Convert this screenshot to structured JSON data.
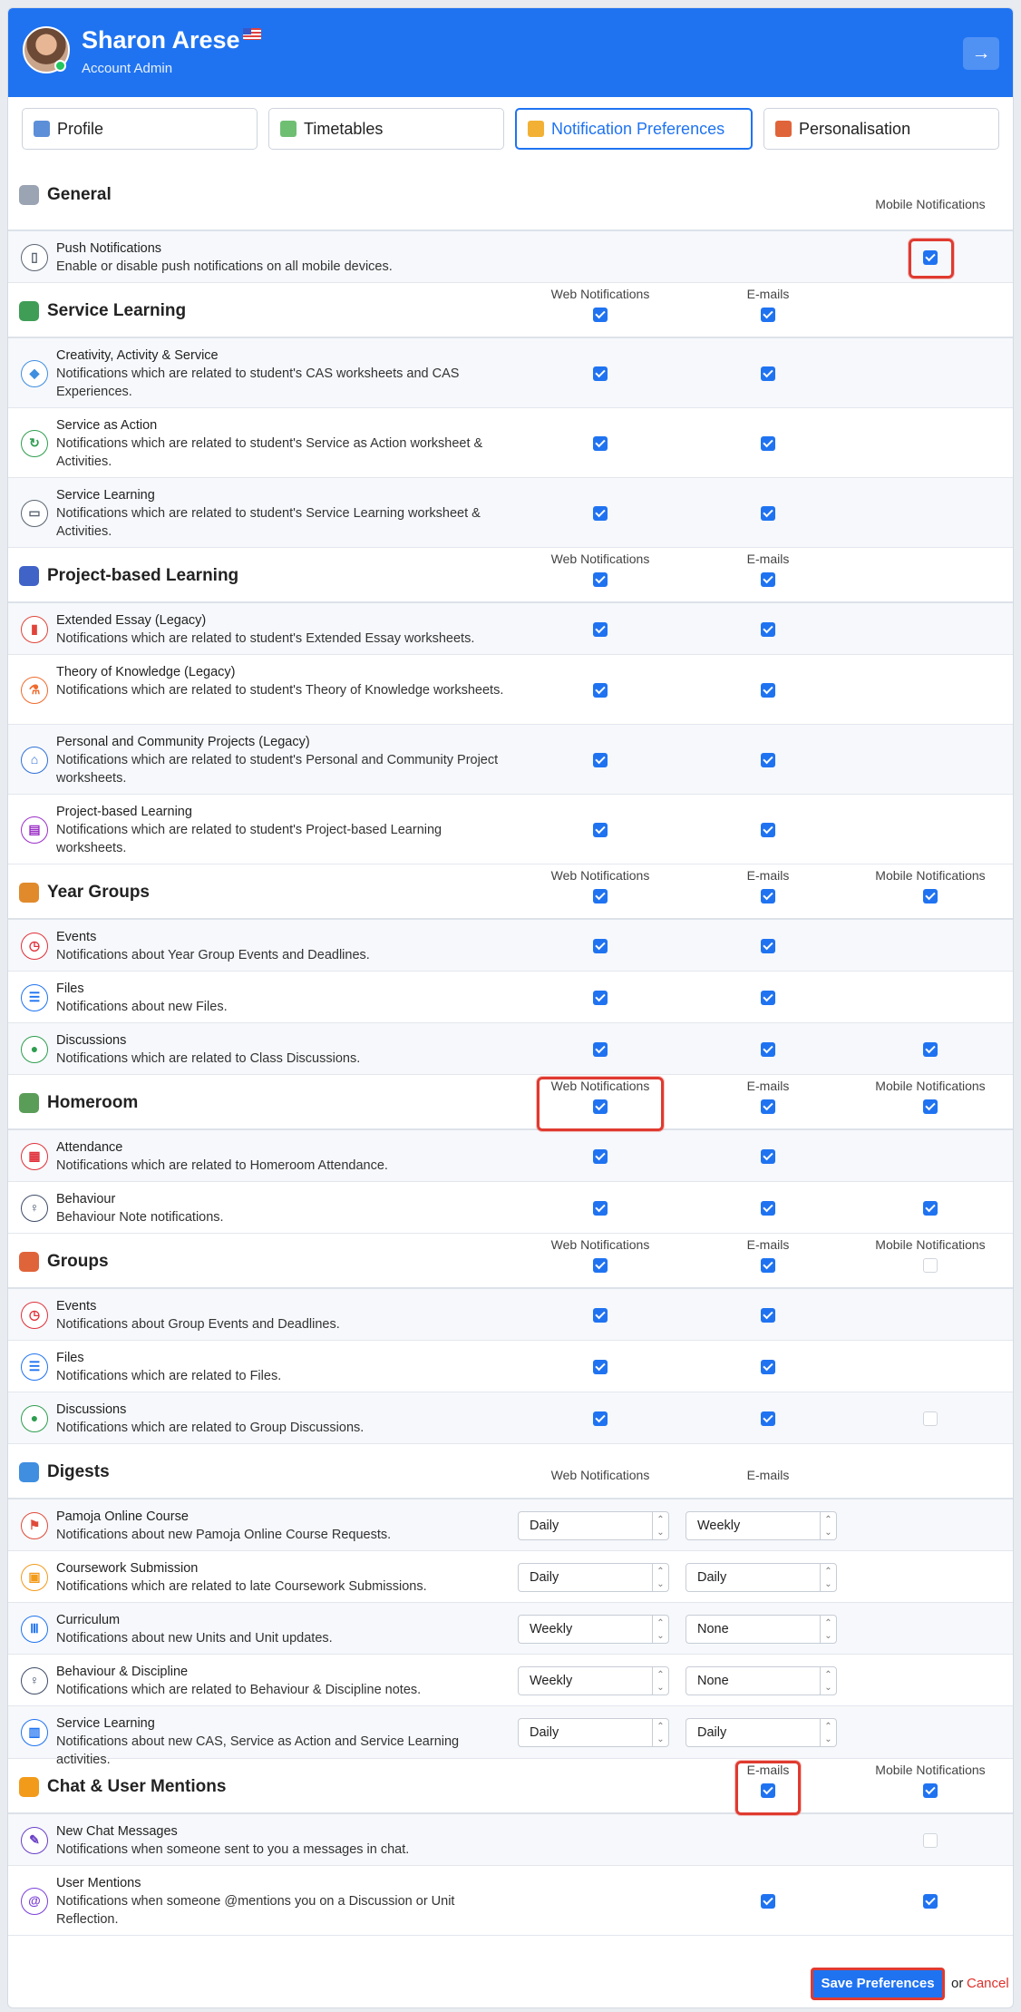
{
  "user": {
    "name": "Sharon Arese",
    "role": "Account Admin"
  },
  "tabs": [
    {
      "label": "Profile",
      "icon": "profile-icon",
      "active": false
    },
    {
      "label": "Timetables",
      "icon": "calendar-icon",
      "active": false
    },
    {
      "label": "Notification Preferences",
      "icon": "notification-icon",
      "active": true
    },
    {
      "label": "Personalisation",
      "icon": "palette-icon",
      "active": false
    }
  ],
  "columns": {
    "web": "Web Notifications",
    "email": "E-mails",
    "mobile": "Mobile Notifications"
  },
  "sections": [
    {
      "title": "General",
      "icon": "gear-icon",
      "cols": [
        "mobile"
      ],
      "rows": [
        {
          "title": "Push Notifications",
          "desc": "Enable or disable push notifications on all mobile devices.",
          "icon": "mobile-icon",
          "mobile": true
        }
      ]
    },
    {
      "title": "Service Learning",
      "icon": "globe-icon",
      "cols": [
        "web",
        "email"
      ],
      "rows": [
        {
          "title": "Creativity, Activity & Service",
          "desc": "Notifications which are related to student's CAS worksheets and CAS Experiences.",
          "icon": "shapes-icon",
          "web": true,
          "email": true
        },
        {
          "title": "Service as Action",
          "desc": "Notifications which are related to student's Service as Action worksheet & Activities.",
          "icon": "refresh-icon",
          "web": true,
          "email": true
        },
        {
          "title": "Service Learning",
          "desc": "Notifications which are related to student's Service Learning worksheet & Activities.",
          "icon": "inbox-icon",
          "web": true,
          "email": true
        }
      ]
    },
    {
      "title": "Project-based Learning",
      "icon": "books-icon",
      "cols": [
        "web",
        "email"
      ],
      "rows": [
        {
          "title": "Extended Essay (Legacy)",
          "desc": "Notifications which are related to student's Extended Essay worksheets.",
          "icon": "book-icon",
          "web": true,
          "email": true
        },
        {
          "title": "Theory of Knowledge (Legacy)",
          "desc": "Notifications which are related to student's Theory of Knowledge worksheets.",
          "icon": "flask-icon",
          "web": true,
          "email": true
        },
        {
          "title": "Personal and Community Projects (Legacy)",
          "desc": "Notifications which are related to student's Personal and Community Project worksheets.",
          "icon": "building-icon",
          "web": true,
          "email": true
        },
        {
          "title": "Project-based Learning",
          "desc": "Notifications which are related to student's Project-based Learning worksheets.",
          "icon": "document-icon",
          "web": true,
          "email": true
        }
      ]
    },
    {
      "title": "Year Groups",
      "icon": "people-icon",
      "cols": [
        "web",
        "email",
        "mobile"
      ],
      "header": {
        "web": true,
        "email": true,
        "mobile": true
      },
      "rows": [
        {
          "title": "Events",
          "desc": "Notifications about Year Group Events and Deadlines.",
          "icon": "clock-icon",
          "web": true,
          "email": true
        },
        {
          "title": "Files",
          "desc": "Notifications about new Files.",
          "icon": "files-icon",
          "web": true,
          "email": true
        },
        {
          "title": "Discussions",
          "desc": "Notifications which are related to Class Discussions.",
          "icon": "chat-icon",
          "web": true,
          "email": true,
          "mobile": true
        }
      ]
    },
    {
      "title": "Homeroom",
      "icon": "family-icon",
      "cols": [
        "web",
        "email",
        "mobile"
      ],
      "header": {
        "web": true,
        "email": true,
        "mobile": true
      },
      "rows": [
        {
          "title": "Attendance",
          "desc": "Notifications which are related to Homeroom Attendance.",
          "icon": "calendar-grid-icon",
          "web": true,
          "email": true
        },
        {
          "title": "Behaviour",
          "desc": "Behaviour Note notifications.",
          "icon": "person-icon",
          "web": true,
          "email": true,
          "mobile": true
        }
      ]
    },
    {
      "title": "Groups",
      "icon": "group-icon",
      "cols": [
        "web",
        "email",
        "mobile"
      ],
      "header": {
        "web": true,
        "email": true,
        "mobile": false
      },
      "rows": [
        {
          "title": "Events",
          "desc": "Notifications about Group Events and Deadlines.",
          "icon": "clock-icon",
          "web": true,
          "email": true
        },
        {
          "title": "Files",
          "desc": "Notifications which are related to Files.",
          "icon": "files-icon",
          "web": true,
          "email": true
        },
        {
          "title": "Discussions",
          "desc": "Notifications which are related to Group Discussions.",
          "icon": "chat-icon",
          "web": true,
          "email": true,
          "mobile": false
        }
      ]
    },
    {
      "title": "Digests",
      "icon": "digest-icon",
      "cols": [
        "web",
        "email"
      ],
      "digest": true,
      "rows": [
        {
          "title": "Pamoja Online Course",
          "desc": "Notifications about new Pamoja Online Course Requests.",
          "icon": "flag-icon",
          "web": "Daily",
          "email": "Weekly"
        },
        {
          "title": "Coursework Submission",
          "desc": "Notifications which are related to late Coursework Submissions.",
          "icon": "clipboard-icon",
          "web": "Daily",
          "email": "Daily"
        },
        {
          "title": "Curriculum",
          "desc": "Notifications about new Units and Unit updates.",
          "icon": "curriculum-icon",
          "web": "Weekly",
          "email": "None"
        },
        {
          "title": "Behaviour & Discipline",
          "desc": "Notifications which are related to Behaviour & Discipline notes.",
          "icon": "person-icon",
          "web": "Weekly",
          "email": "None"
        },
        {
          "title": "Service Learning",
          "desc": "Notifications about new CAS, Service as Action and Service Learning activities.",
          "icon": "chart-icon",
          "web": "Daily",
          "email": "Daily"
        }
      ]
    },
    {
      "title": "Chat & User Mentions",
      "icon": "chat-bubble-icon",
      "cols": [
        "email",
        "mobile"
      ],
      "header": {
        "email": true,
        "mobile": true
      },
      "rows": [
        {
          "title": "New Chat Messages",
          "desc": "Notifications when someone sent to you a messages in chat.",
          "icon": "edit-icon",
          "mobile": false
        },
        {
          "title": "User Mentions",
          "desc": "Notifications when someone @mentions you on a Discussion or Unit Reflection.",
          "icon": "at-icon",
          "email": true,
          "mobile": true
        }
      ]
    }
  ],
  "actions": {
    "save": "Save Preferences",
    "or": "or",
    "cancel": "Cancel"
  },
  "colors": {
    "accent": "#1f73f1",
    "highlight": "#e03a30",
    "cancel": "#e0302a"
  }
}
